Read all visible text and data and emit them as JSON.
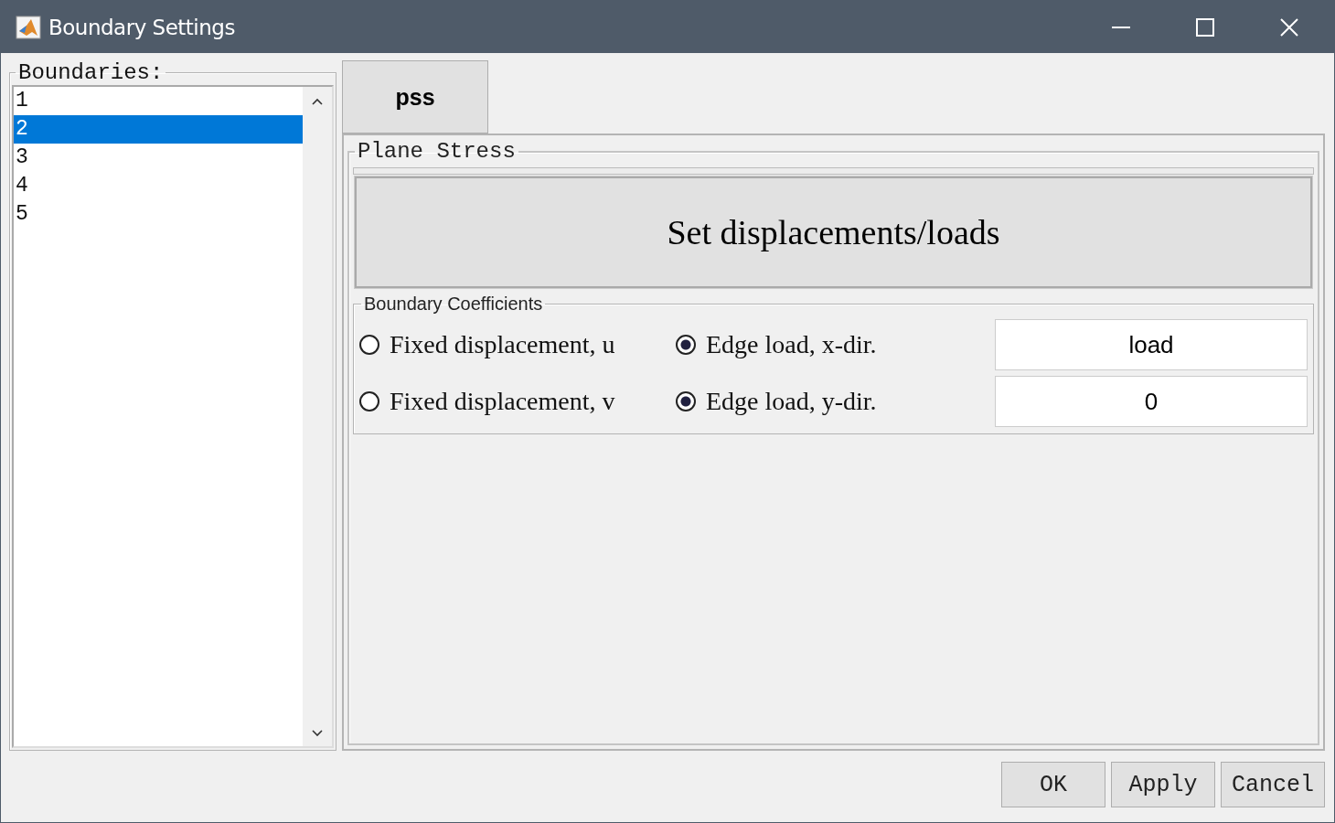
{
  "window": {
    "title": "Boundary Settings"
  },
  "boundaries": {
    "label": "Boundaries:",
    "items": [
      {
        "label": "1",
        "selected": false
      },
      {
        "label": "2",
        "selected": true
      },
      {
        "label": "3",
        "selected": false
      },
      {
        "label": "4",
        "selected": false
      },
      {
        "label": "5",
        "selected": false
      }
    ]
  },
  "mode_button": "pss",
  "panel": {
    "title": "Plane Stress",
    "action_button": "Set displacements/loads",
    "coefficients": {
      "title": "Boundary Coefficients",
      "rows": [
        {
          "left": {
            "label": "Fixed displacement, u",
            "checked": false
          },
          "right": {
            "label": "Edge load, x-dir.",
            "checked": true
          },
          "value": "load"
        },
        {
          "left": {
            "label": "Fixed displacement, v",
            "checked": false
          },
          "right": {
            "label": "Edge load, y-dir.",
            "checked": true
          },
          "value": "0"
        }
      ]
    }
  },
  "buttons": [
    "OK",
    "Apply",
    "Cancel"
  ]
}
